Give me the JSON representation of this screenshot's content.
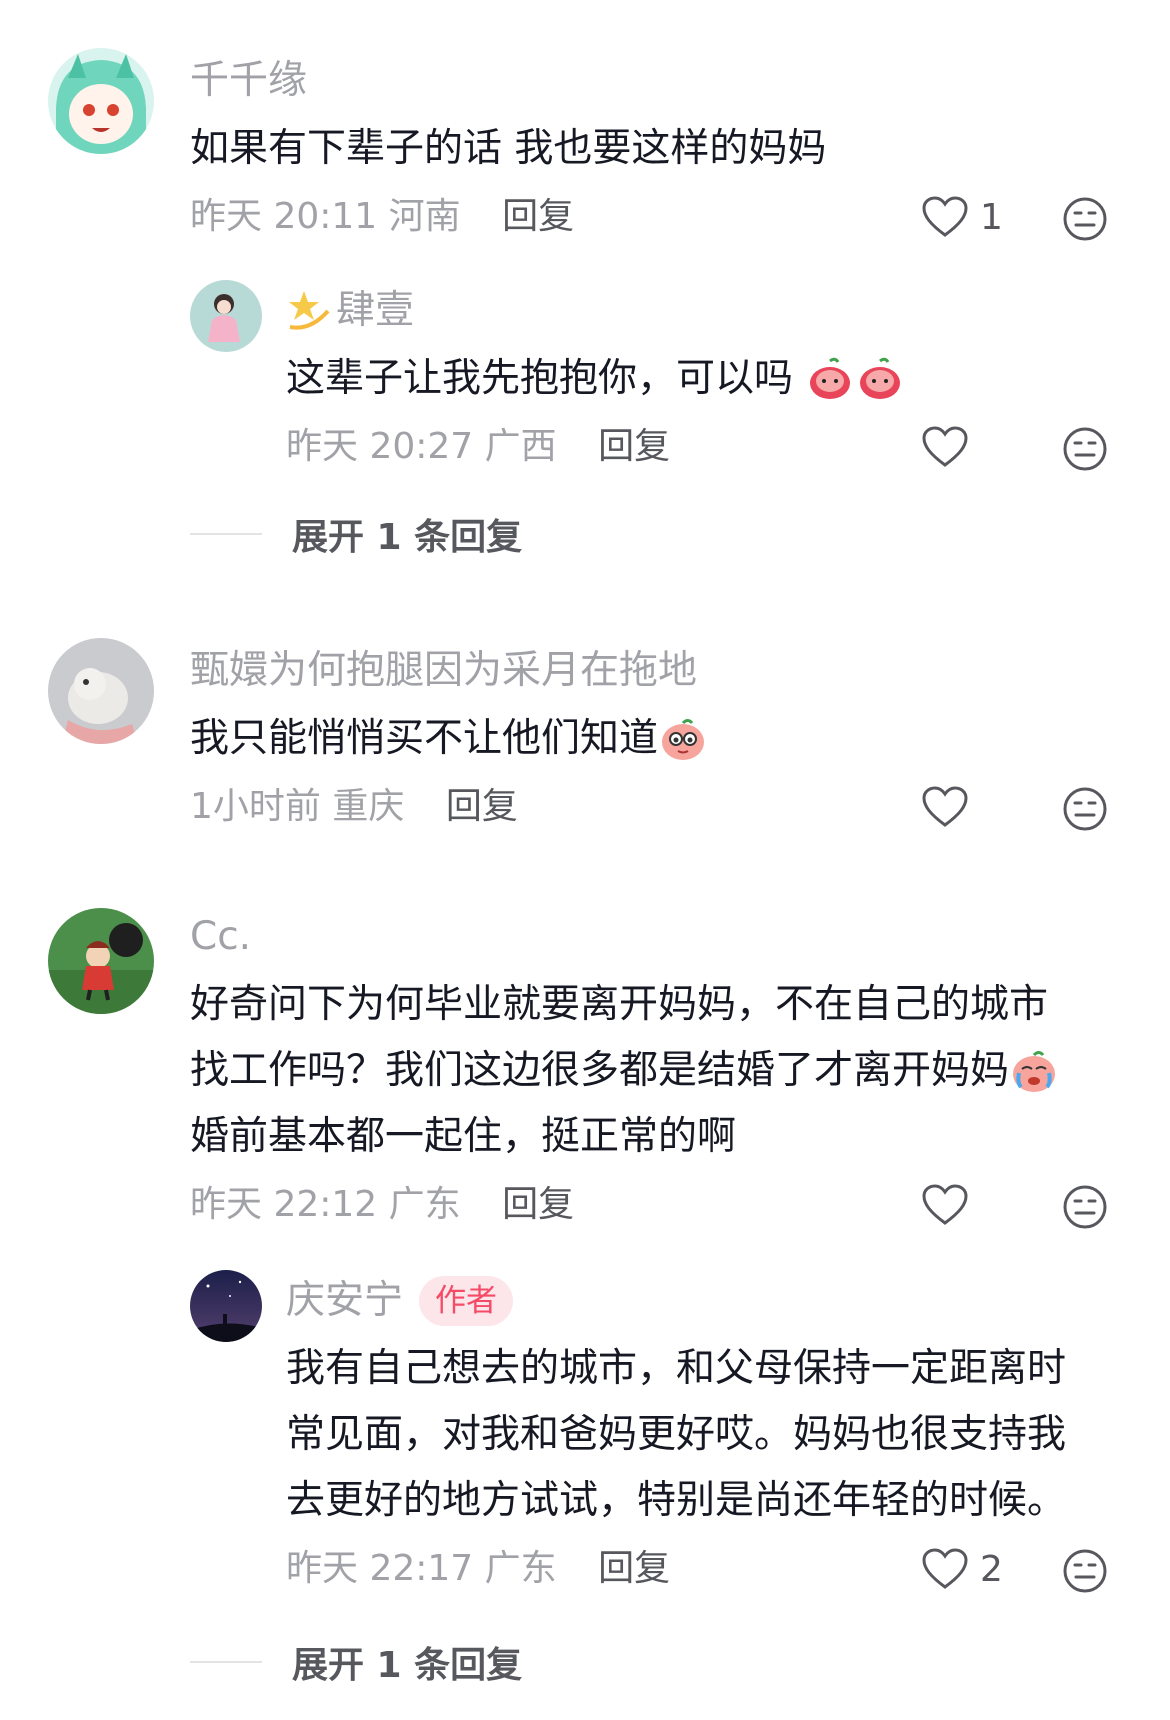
{
  "comments": [
    {
      "user": "千千缘",
      "text": "如果有下辈子的话 我也要这样的妈妈",
      "time": "昨天 20:11",
      "location": "河南",
      "reply_label": "回复",
      "likes": "1",
      "replies": [
        {
          "user": "肆壹",
          "user_emoji": "dizzy-star",
          "text": "这辈子让我先抱抱你，可以吗",
          "time": "昨天 20:27",
          "location": "广西",
          "reply_label": "回复",
          "likes": ""
        }
      ],
      "expand_label": "展开 1 条回复"
    },
    {
      "user": "甄嬛为何抱腿因为采月在拖地",
      "text": "我只能悄悄买不让他们知道",
      "time": "1小时前",
      "location": "重庆",
      "reply_label": "回复",
      "likes": ""
    },
    {
      "user": "Cc.",
      "text_lines": [
        "好奇问下为何毕业就要离开妈妈，不在自己的城市",
        "找工作吗？我们这边很多都是结婚了才离开妈妈",
        "婚前基本都一起住，挺正常的啊"
      ],
      "time": "昨天 22:12",
      "location": "广东",
      "reply_label": "回复",
      "likes": "",
      "replies": [
        {
          "user": "庆安宁",
          "badge": "作者",
          "text_lines": [
            "我有自己想去的城市，和父母保持一定距离时",
            "常见面，对我和爸妈更好哎。妈妈也很支持我",
            "去更好的地方试试，特别是尚还年轻的时候。"
          ],
          "time": "昨天 22:17",
          "location": "广东",
          "reply_label": "回复",
          "likes": "2"
        }
      ],
      "expand_label": "展开 1 条回复"
    }
  ],
  "colors": {
    "username": "#a1a2a7",
    "text": "#161823",
    "badge_bg": "#fde6e9",
    "badge_text": "#f44b66"
  }
}
